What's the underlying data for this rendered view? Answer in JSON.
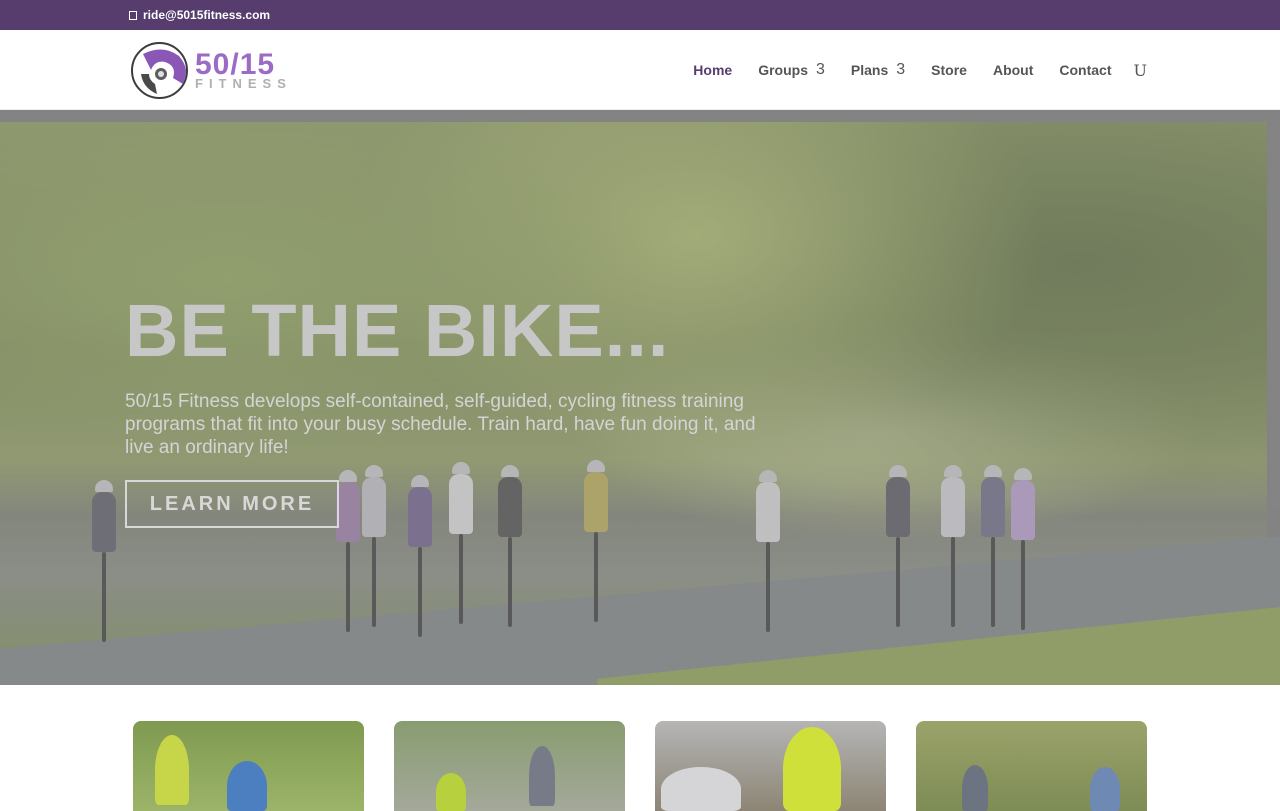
{
  "topbar": {
    "email": "ride@5015fitness.com",
    "mail_icon": "envelope-icon",
    "color": "#563d6e"
  },
  "header": {
    "logo": {
      "main": "50/15",
      "sub": "FITNESS",
      "color": "#9b6bc5"
    },
    "nav": [
      {
        "label": "Home",
        "active": true
      },
      {
        "label": "Groups",
        "caret": "3"
      },
      {
        "label": "Plans",
        "caret": "3"
      },
      {
        "label": "Store"
      },
      {
        "label": "About"
      },
      {
        "label": "Contact"
      }
    ],
    "search_glyph": "U"
  },
  "hero": {
    "title": "BE THE BIKE...",
    "text": "50/15 Fitness develops self-contained, self-guided, cycling fitness training programs that fit into your busy schedule. Train hard, have fun doing it, and live an ordinary life!",
    "button": "LEARN MORE"
  },
  "cards": [
    {
      "name": "card-1",
      "kind": "photo"
    },
    {
      "name": "card-2",
      "kind": "photo"
    },
    {
      "name": "card-3",
      "kind": "photo"
    },
    {
      "name": "card-4",
      "kind": "photo"
    }
  ]
}
